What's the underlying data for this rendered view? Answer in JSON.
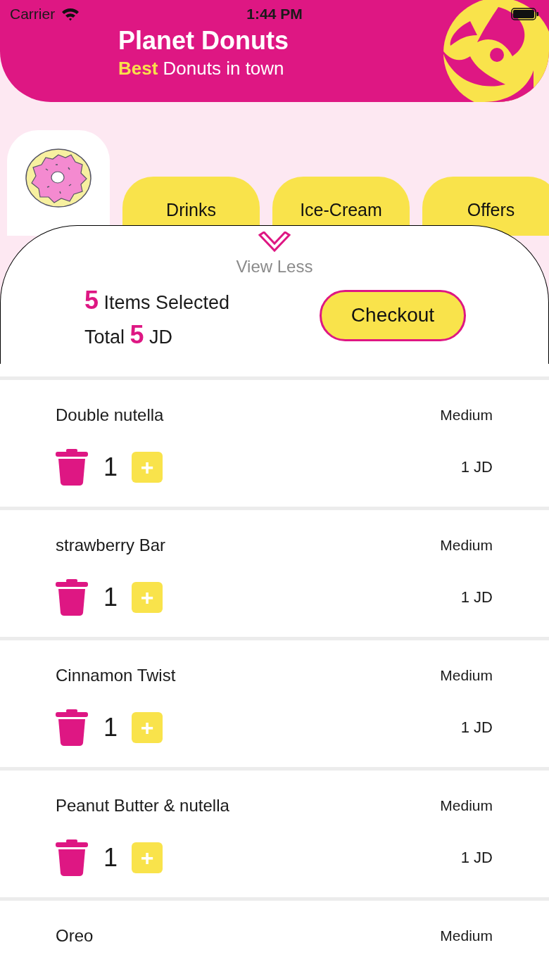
{
  "status_bar": {
    "carrier": "Carrier",
    "time": "1:44 PM"
  },
  "header": {
    "title": "Planet Donuts",
    "tagline": "**Best** Donuts in town"
  },
  "tabs": [
    {
      "kind": "icon",
      "selected": true
    },
    {
      "kind": "text",
      "label": "Drinks",
      "selected": false
    },
    {
      "kind": "text",
      "label": "Ice-Cream",
      "selected": false
    },
    {
      "kind": "text",
      "label": "Offers",
      "selected": false
    }
  ],
  "cart_sheet": {
    "toggle_label": "View Less",
    "items_selected": "**5** Items Selected",
    "total": "Total **5** JD",
    "checkout_button": "Checkout"
  },
  "cart_items": [
    {
      "name": "Double nutella",
      "size": "Medium",
      "quantity": "1",
      "add": "+",
      "price": "1 JD"
    },
    {
      "name": "strawberry Bar",
      "size": "Medium",
      "quantity": "1",
      "add": "+",
      "price": "1 JD"
    },
    {
      "name": "Cinnamon Twist",
      "size": "Medium",
      "quantity": "1",
      "add": "+",
      "price": "1 JD"
    },
    {
      "name": "Peanut Butter & nutella",
      "size": "Medium",
      "quantity": "1",
      "add": "+",
      "price": "1 JD"
    },
    {
      "name": "Oreo",
      "size": "Medium"
    }
  ]
}
